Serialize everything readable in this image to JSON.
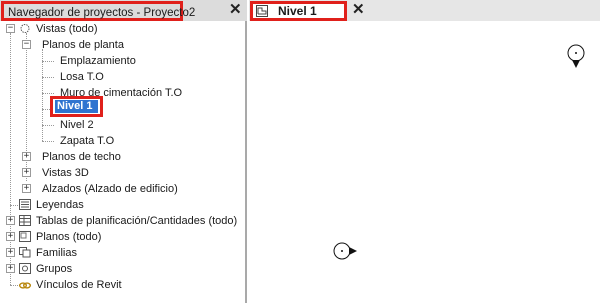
{
  "browser": {
    "title": "Navegador de proyectos - Proyecto2",
    "close_glyph": "✕",
    "tree": {
      "vistas": "Vistas (todo)",
      "planos_planta": "Planos de planta",
      "emplazamiento": "Emplazamiento",
      "losa": "Losa T.O",
      "muro": "Muro de cimentación T.O",
      "nivel1": "Nivel 1",
      "nivel2": "Nivel 2",
      "zapata": "Zapata T.O",
      "planos_techo": "Planos de techo",
      "vistas3d": "Vistas 3D",
      "alzados": "Alzados (Alzado de edificio)",
      "leyendas": "Leyendas",
      "tablas": "Tablas de planificación/Cantidades (todo)",
      "planos": "Planos (todo)",
      "familias": "Familias",
      "grupos": "Grupos",
      "vinculos": "Vínculos de Revit"
    },
    "toggle_expanded": "−",
    "toggle_collapsed": "+"
  },
  "view": {
    "tab_label": "Nivel 1",
    "close_glyph": "✕"
  },
  "colors": {
    "highlight": "#e0201b",
    "selection": "#2f74d0"
  }
}
